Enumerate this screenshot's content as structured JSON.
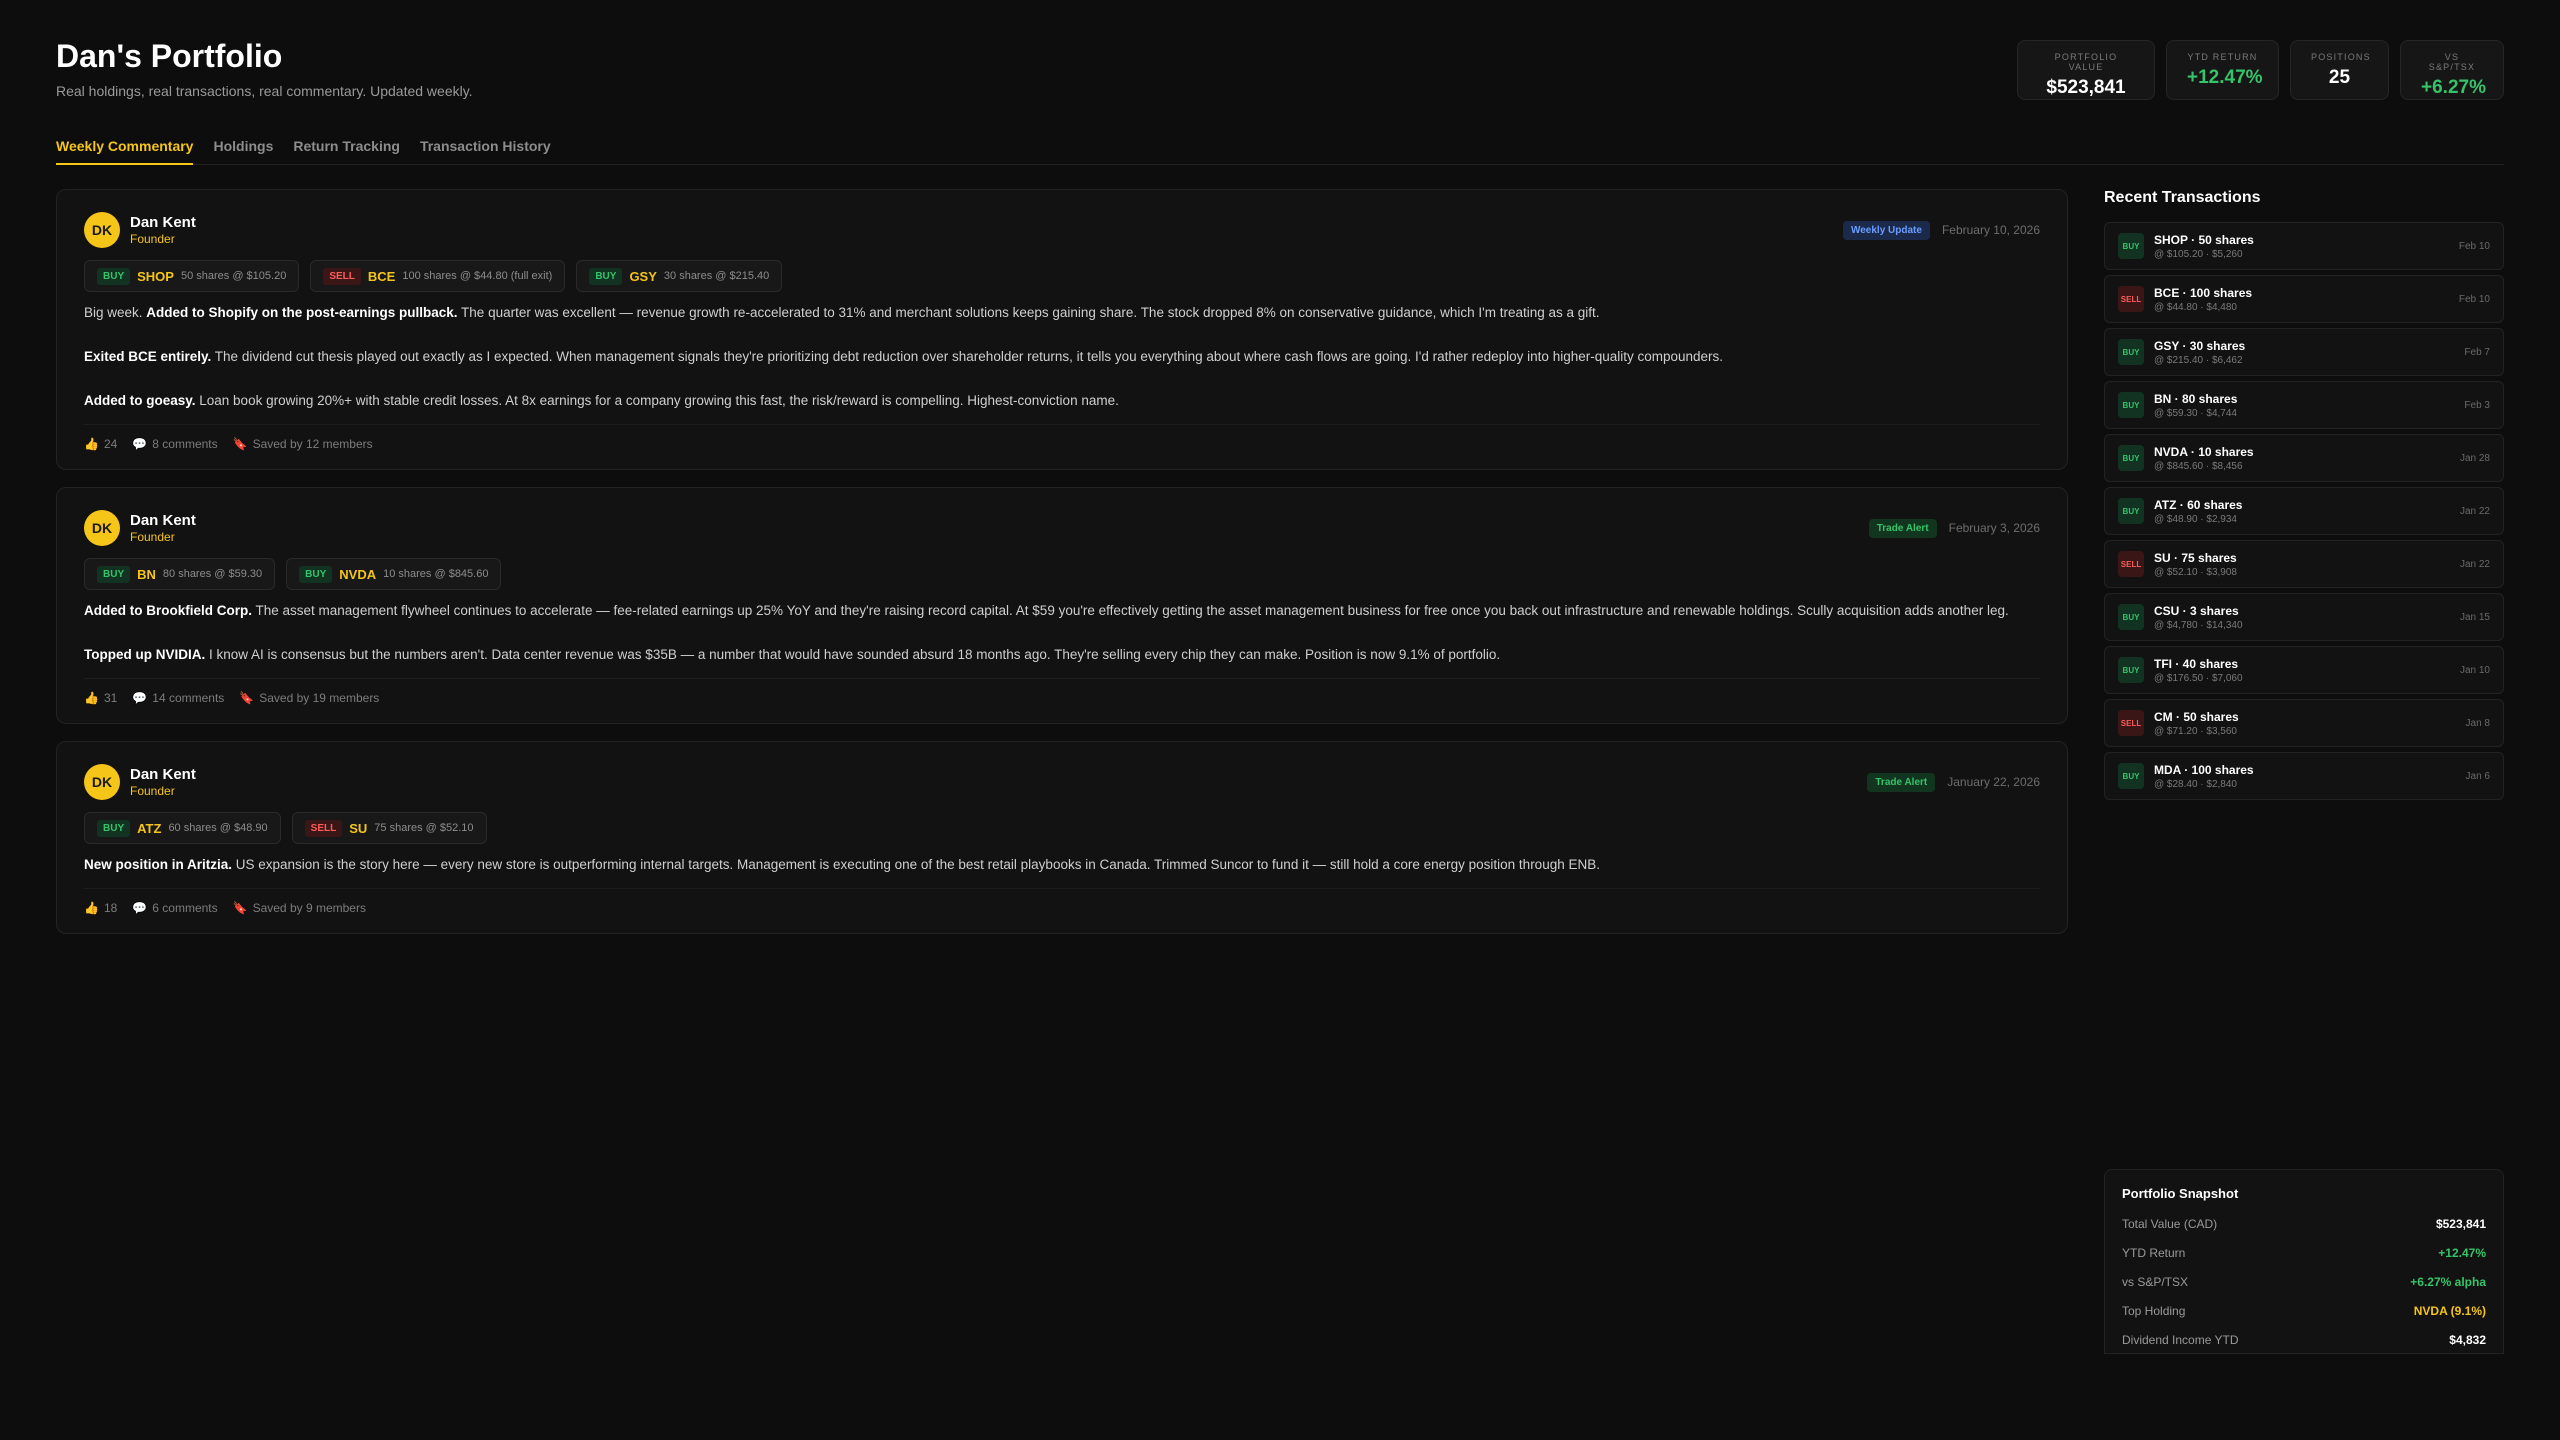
{
  "header": {
    "title": "Dan's Portfolio",
    "subtitle": "Real holdings, real transactions, real commentary. Updated weekly."
  },
  "stats": [
    {
      "label": "Portfolio Value",
      "value": "$523,841",
      "tone": "white"
    },
    {
      "label": "YTD Return",
      "value": "+12.47%",
      "tone": "green"
    },
    {
      "label": "Positions",
      "value": "25",
      "tone": "white"
    },
    {
      "label": "vs S&P/TSX",
      "value": "+6.27%",
      "tone": "green"
    }
  ],
  "tabs": [
    {
      "label": "Weekly Commentary",
      "active": true
    },
    {
      "label": "Holdings",
      "active": false
    },
    {
      "label": "Return Tracking",
      "active": false
    },
    {
      "label": "Transaction History",
      "active": false
    }
  ],
  "posts": [
    {
      "author": "Dan Kent",
      "initials": "DK",
      "role": "Founder",
      "badge": "Weekly Update",
      "badge_type": "weekly",
      "date": "February 10, 2026",
      "trades": [
        {
          "type": "BUY",
          "ticker": "SHOP",
          "detail": "50 shares @ $105.20"
        },
        {
          "type": "SELL",
          "ticker": "BCE",
          "detail": "100 shares @ $44.80 (full exit)"
        },
        {
          "type": "BUY",
          "ticker": "GSY",
          "detail": "30 shares @ $215.40"
        }
      ],
      "paragraphs": [
        {
          "pre": "Big week. ",
          "bold": "Added to Shopify on the post-earnings pullback.",
          "text": " The quarter was excellent — revenue growth re-accelerated to 31% and merchant solutions keeps gaining share. The stock dropped 8% on conservative guidance, which I'm treating as a gift."
        },
        {
          "pre": "",
          "bold": "Exited BCE entirely.",
          "text": " The dividend cut thesis played out exactly as I expected. When management signals they're prioritizing debt reduction over shareholder returns, it tells you everything about where cash flows are going. I'd rather redeploy into higher-quality compounders."
        },
        {
          "pre": "",
          "bold": "Added to goeasy.",
          "text": " Loan book growing 20%+ with stable credit losses. At 8x earnings for a company growing this fast, the risk/reward is compelling. Highest-conviction name."
        }
      ],
      "likes": "24",
      "comments": "8 comments",
      "saved": "Saved by 12 members"
    },
    {
      "author": "Dan Kent",
      "initials": "DK",
      "role": "Founder",
      "badge": "Trade Alert",
      "badge_type": "alert",
      "date": "February 3, 2026",
      "trades": [
        {
          "type": "BUY",
          "ticker": "BN",
          "detail": "80 shares @ $59.30"
        },
        {
          "type": "BUY",
          "ticker": "NVDA",
          "detail": "10 shares @ $845.60"
        }
      ],
      "paragraphs": [
        {
          "pre": "",
          "bold": "Added to Brookfield Corp.",
          "text": " The asset management flywheel continues to accelerate — fee-related earnings up 25% YoY and they're raising record capital. At $59 you're effectively getting the asset management business for free once you back out infrastructure and renewable holdings. Scully acquisition adds another leg."
        },
        {
          "pre": "",
          "bold": "Topped up NVIDIA.",
          "text": " I know AI is consensus but the numbers aren't. Data center revenue was $35B — a number that would have sounded absurd 18 months ago. They're selling every chip they can make. Position is now 9.1% of portfolio."
        }
      ],
      "likes": "31",
      "comments": "14 comments",
      "saved": "Saved by 19 members"
    },
    {
      "author": "Dan Kent",
      "initials": "DK",
      "role": "Founder",
      "badge": "Trade Alert",
      "badge_type": "alert",
      "date": "January 22, 2026",
      "trades": [
        {
          "type": "BUY",
          "ticker": "ATZ",
          "detail": "60 shares @ $48.90"
        },
        {
          "type": "SELL",
          "ticker": "SU",
          "detail": "75 shares @ $52.10"
        }
      ],
      "paragraphs": [
        {
          "pre": "",
          "bold": "New position in Aritzia.",
          "text": " US expansion is the story here — every new store is outperforming internal targets. Management is executing one of the best retail playbooks in Canada. Trimmed Suncor to fund it — still hold a core energy position through ENB."
        }
      ],
      "likes": "18",
      "comments": "6 comments",
      "saved": "Saved by 9 members"
    }
  ],
  "sidebar": {
    "title": "Recent Transactions",
    "transactions": [
      {
        "type": "BUY",
        "title": "SHOP · 50 shares",
        "sub": "@ $105.20 · $5,260",
        "date": "Feb 10"
      },
      {
        "type": "SELL",
        "title": "BCE · 100 shares",
        "sub": "@ $44.80 · $4,480",
        "date": "Feb 10"
      },
      {
        "type": "BUY",
        "title": "GSY · 30 shares",
        "sub": "@ $215.40 · $6,462",
        "date": "Feb 7"
      },
      {
        "type": "BUY",
        "title": "BN · 80 shares",
        "sub": "@ $59.30 · $4,744",
        "date": "Feb 3"
      },
      {
        "type": "BUY",
        "title": "NVDA · 10 shares",
        "sub": "@ $845.60 · $8,456",
        "date": "Jan 28"
      },
      {
        "type": "BUY",
        "title": "ATZ · 60 shares",
        "sub": "@ $48.90 · $2,934",
        "date": "Jan 22"
      },
      {
        "type": "SELL",
        "title": "SU · 75 shares",
        "sub": "@ $52.10 · $3,908",
        "date": "Jan 22"
      },
      {
        "type": "BUY",
        "title": "CSU · 3 shares",
        "sub": "@ $4,780 · $14,340",
        "date": "Jan 15"
      },
      {
        "type": "BUY",
        "title": "TFI · 40 shares",
        "sub": "@ $176.50 · $7,060",
        "date": "Jan 10"
      },
      {
        "type": "SELL",
        "title": "CM · 50 shares",
        "sub": "@ $71.20 · $3,560",
        "date": "Jan 8"
      },
      {
        "type": "BUY",
        "title": "MDA · 100 shares",
        "sub": "@ $28.40 · $2,840",
        "date": "Jan 6"
      }
    ]
  },
  "snapshot": {
    "title": "Portfolio Snapshot",
    "rows": [
      {
        "label": "Total Value (CAD)",
        "value": "$523,841",
        "tone": "white"
      },
      {
        "label": "YTD Return",
        "value": "+12.47%",
        "tone": "green"
      },
      {
        "label": "vs S&P/TSX",
        "value": "+6.27% alpha",
        "tone": "green"
      },
      {
        "label": "Top Holding",
        "value": "NVDA (9.1%)",
        "tone": "gold"
      },
      {
        "label": "Dividend Income YTD",
        "value": "$4,832",
        "tone": "white"
      }
    ]
  },
  "icons": {
    "like": "thumbs-up-icon",
    "comment": "speech-bubble-icon",
    "save": "bookmark-icon"
  },
  "colors": {
    "accent": "#f5c518",
    "positive": "#35c46a",
    "negative": "#ff5c5c",
    "background": "#0d0d0d"
  }
}
